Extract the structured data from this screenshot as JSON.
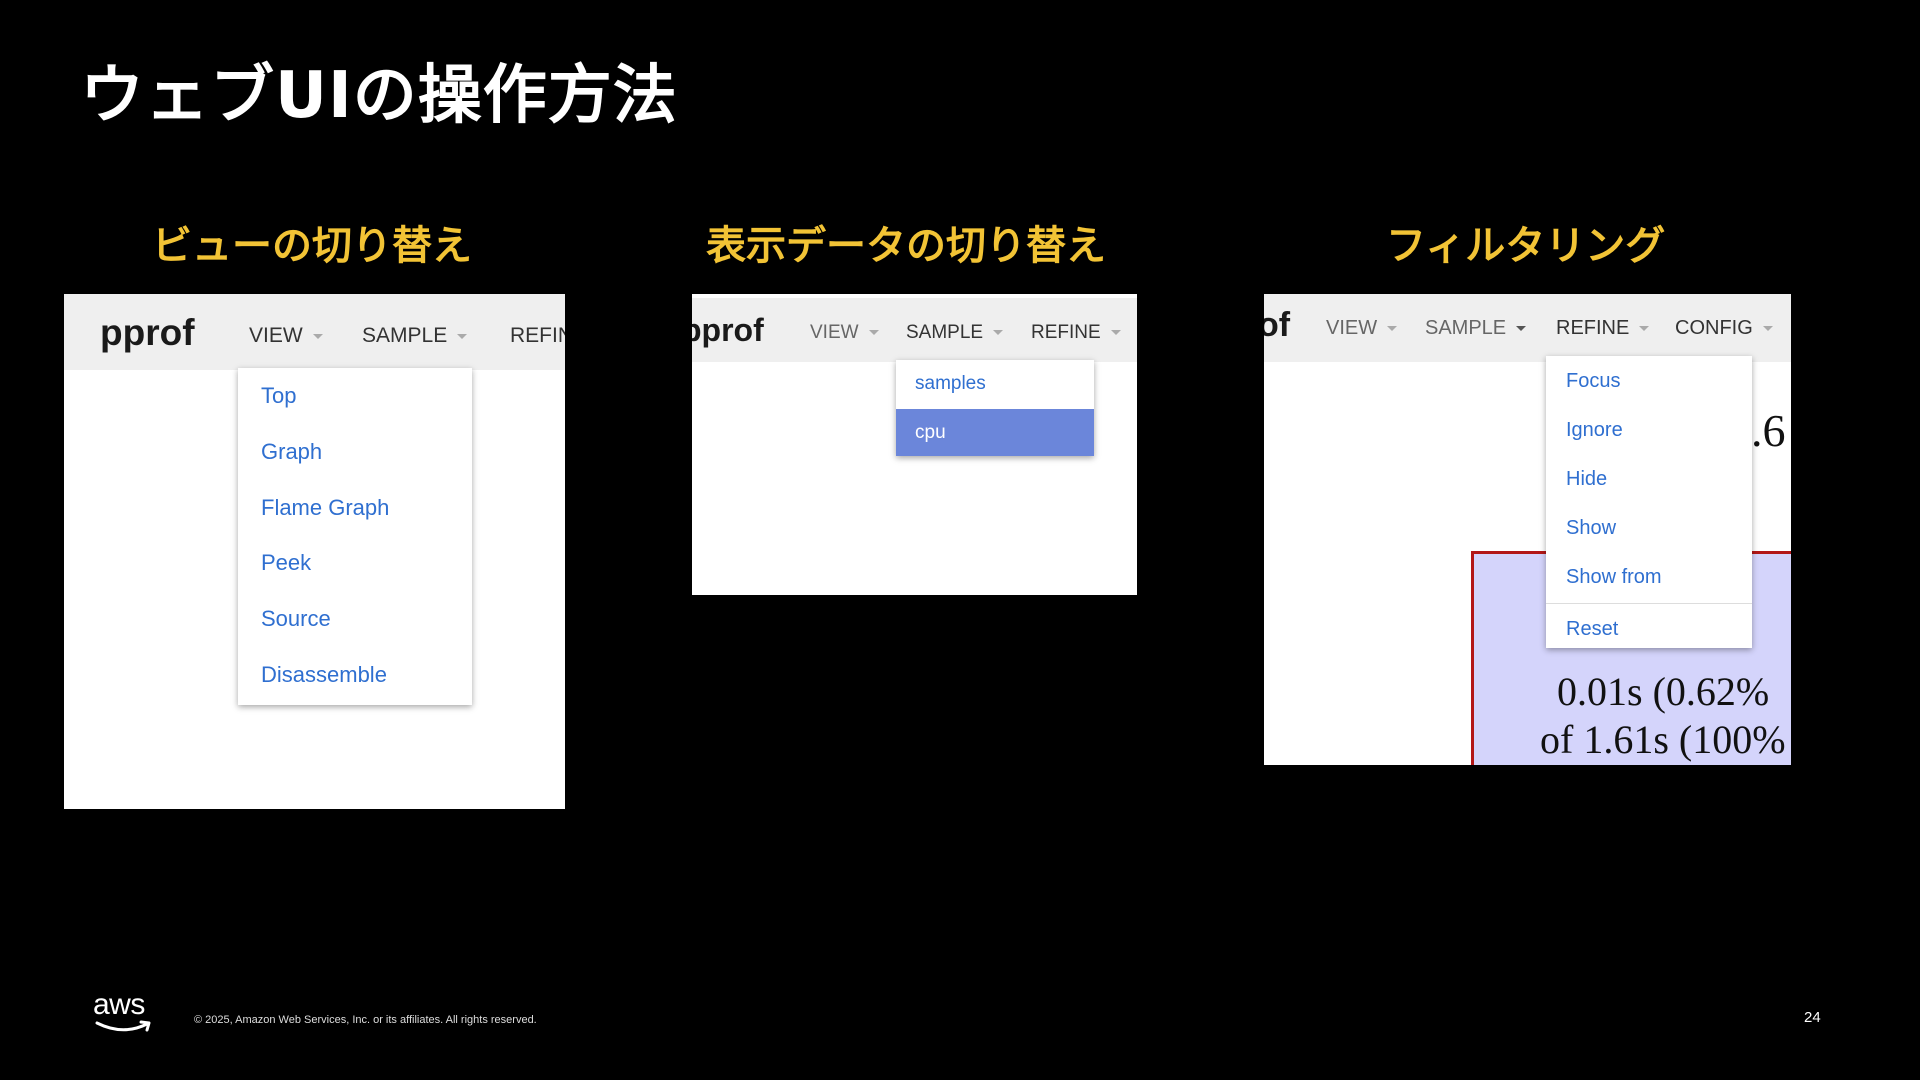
{
  "slide": {
    "title": "ウェブUIの操作方法",
    "page_number": "24",
    "copyright": "© 2025, Amazon Web Services, Inc. or its affiliates. All rights reserved.",
    "logo_text": "aws"
  },
  "sections": [
    {
      "title": "ビューの切り替え"
    },
    {
      "title": "表示データの切り替え"
    },
    {
      "title": "フィルタリング"
    }
  ],
  "panel1": {
    "logo": "pprof",
    "menu": [
      "VIEW",
      "SAMPLE",
      "REFIN"
    ],
    "dropdown": [
      "Top",
      "Graph",
      "Flame Graph",
      "Peek",
      "Source",
      "Disassemble"
    ]
  },
  "panel2": {
    "logo": "pprof",
    "menu": [
      "VIEW",
      "SAMPLE",
      "REFINE"
    ],
    "dropdown": [
      "samples",
      "cpu"
    ],
    "selected": "cpu"
  },
  "panel3": {
    "logo": "of",
    "menu": [
      "VIEW",
      "SAMPLE",
      "REFINE",
      "CONFIG"
    ],
    "dropdown": [
      "Focus",
      "Ignore",
      "Hide",
      "Show",
      "Show from",
      "Reset"
    ],
    "graph_text": [
      ".6",
      "0.01s (0.62%",
      "of 1.61s (100%"
    ]
  },
  "colors": {
    "background": "#000000",
    "section_title": "#f2c335",
    "link_blue": "#2f6fd0",
    "selected_bg": "#6b86da",
    "node_border": "#b31717",
    "node_fill": "#d4d4fb"
  }
}
